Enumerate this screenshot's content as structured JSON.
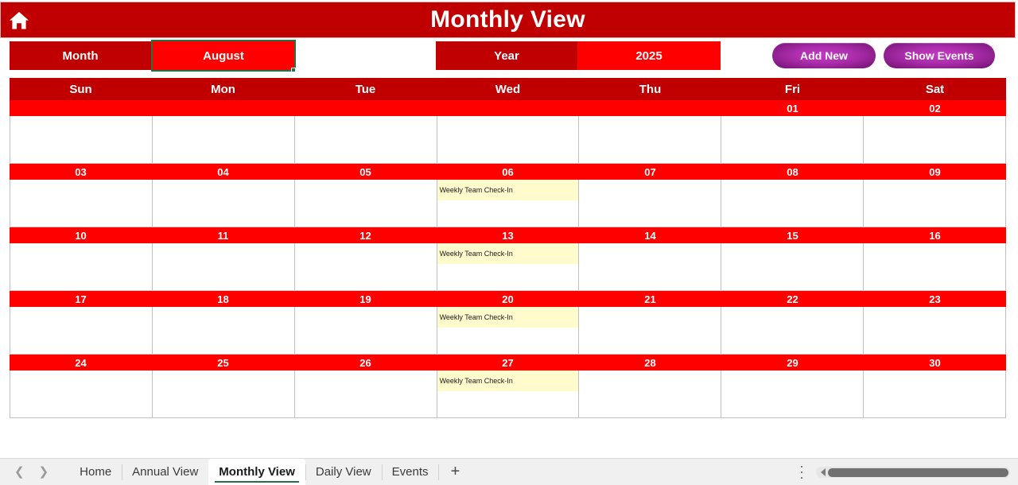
{
  "titlebar": {
    "title": "Monthly View",
    "home_icon": "home-icon"
  },
  "controls": {
    "month_label": "Month",
    "month_value": "August",
    "month_dropdown_icon": "chevron-down-icon",
    "year_label": "Year",
    "year_value": "2025",
    "add_new_label": "Add New",
    "show_events_label": "Show Events",
    "accent_dark_red": "#C00000",
    "accent_bright_red": "#FF0000",
    "accent_purple": "#8E1F8E",
    "selection_green": "#217346"
  },
  "calendar": {
    "weekdays": [
      "Sun",
      "Mon",
      "Tue",
      "Wed",
      "Thu",
      "Fri",
      "Sat"
    ],
    "event_bg": "#FFFBCC",
    "weeks": [
      {
        "dates": [
          "",
          "",
          "",
          "",
          "",
          "01",
          "02"
        ],
        "events": [
          "",
          "",
          "",
          "",
          "",
          "",
          ""
        ]
      },
      {
        "dates": [
          "03",
          "04",
          "05",
          "06",
          "07",
          "08",
          "09"
        ],
        "events": [
          "",
          "",
          "",
          "Weekly Team Check-In",
          "",
          "",
          ""
        ]
      },
      {
        "dates": [
          "10",
          "11",
          "12",
          "13",
          "14",
          "15",
          "16"
        ],
        "events": [
          "",
          "",
          "",
          "Weekly Team Check-In",
          "",
          "",
          ""
        ]
      },
      {
        "dates": [
          "17",
          "18",
          "19",
          "20",
          "21",
          "22",
          "23"
        ],
        "events": [
          "",
          "",
          "",
          "Weekly Team Check-In",
          "",
          "",
          ""
        ]
      },
      {
        "dates": [
          "24",
          "25",
          "26",
          "27",
          "28",
          "29",
          "30"
        ],
        "events": [
          "",
          "",
          "",
          "Weekly Team Check-In",
          "",
          "",
          ""
        ]
      }
    ]
  },
  "sheetbar": {
    "prev_icon": "chevron-left-icon",
    "next_icon": "chevron-right-icon",
    "tabs": [
      {
        "label": "Home",
        "active": false
      },
      {
        "label": "Annual View",
        "active": false
      },
      {
        "label": "Monthly View",
        "active": true
      },
      {
        "label": "Daily View",
        "active": false
      },
      {
        "label": "Events",
        "active": false
      }
    ],
    "add_sheet_label": "+",
    "kebab_icon": "more-vertical-icon",
    "scrollbar_icon": "horizontal-scrollbar"
  }
}
